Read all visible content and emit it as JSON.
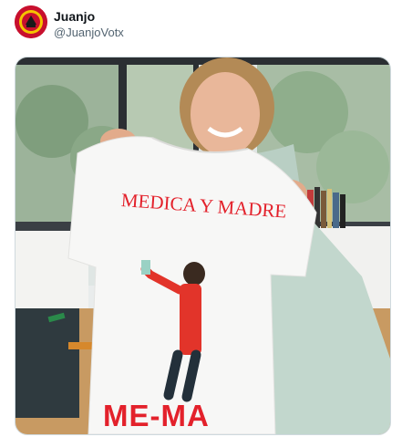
{
  "tweet": {
    "author_name": "Juanjo",
    "author_handle": "@JuanjoVotx"
  },
  "media": {
    "shirt_text_top": "MEDICA Y MADRE",
    "shirt_text_bottom": "ME-MA"
  },
  "colors": {
    "shirt_text": "#e3212b",
    "avatar_bg": "#c8102e"
  }
}
